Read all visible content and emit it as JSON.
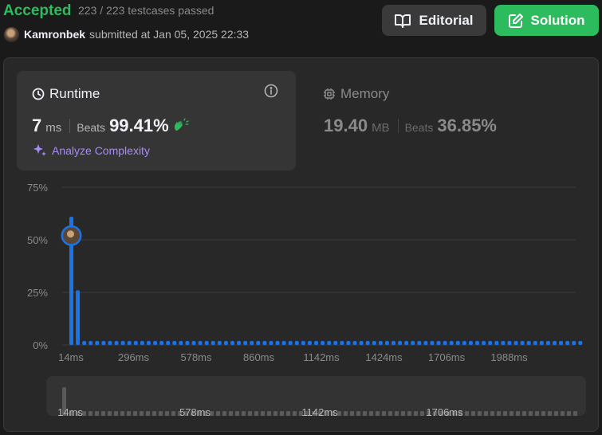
{
  "header": {
    "status": "Accepted",
    "testcases": "223 / 223 testcases passed",
    "username": "Kamronbek",
    "submitted_text": "submitted at Jan 05, 2025 22:33"
  },
  "buttons": {
    "editorial": "Editorial",
    "solution": "Solution"
  },
  "runtime": {
    "title": "Runtime",
    "value": "7",
    "unit": "ms",
    "beats_label": "Beats",
    "beats_pct": "99.41%",
    "analyze_label": "Analyze Complexity"
  },
  "memory": {
    "title": "Memory",
    "value": "19.40",
    "unit": "MB",
    "beats_label": "Beats",
    "beats_pct": "36.85%"
  },
  "colors": {
    "accent_green": "#2cbb5d",
    "bar_blue": "#1a73e8",
    "analyze_purple": "#a78bfa"
  },
  "icons": {
    "editorial": "book-open-icon",
    "solution": "edit-icon",
    "runtime": "clock-icon",
    "info": "info-icon",
    "memory": "chip-icon",
    "analyze": "sparkle-icon",
    "beats": "clapping-hands-icon"
  },
  "chart_data": {
    "type": "bar",
    "ylim": [
      0,
      75
    ],
    "yticks": [
      "0%",
      "25%",
      "50%",
      "75%"
    ],
    "xticks": [
      "14ms",
      "296ms",
      "578ms",
      "860ms",
      "1142ms",
      "1424ms",
      "1706ms",
      "1988ms"
    ],
    "values": [
      61,
      26,
      1.5,
      1.5,
      1.5,
      1.5,
      1.5,
      1.5,
      1.5,
      1.5,
      1.5,
      1.5,
      1.5,
      1.5,
      1.5,
      1.5,
      1.5,
      1.5,
      1.5,
      1.5,
      1.5,
      1.5,
      1.5,
      1.5,
      1.5,
      1.5,
      1.5,
      1.5,
      1.5,
      1.5,
      1.5,
      1.5,
      1.5,
      1.5,
      1.5,
      1.5,
      1.5,
      1.5,
      1.5,
      1.5,
      1.5,
      1.5,
      1.5,
      1.5,
      1.5,
      1.5,
      1.5,
      1.5,
      1.5,
      1.5,
      1.5,
      1.5,
      1.5,
      1.5,
      1.5,
      1.5,
      1.5,
      1.5,
      1.5,
      1.5,
      1.5,
      1.5,
      1.5,
      1.5,
      1.5,
      1.5,
      1.5,
      1.5,
      1.5,
      1.5,
      1.5,
      1.5,
      1.5,
      1.5,
      1.5,
      1.5,
      1.5,
      1.5,
      1.5,
      1.5
    ],
    "user_marker_index": 0,
    "user_marker_value": 52,
    "grid": true,
    "brush_xticks": [
      "14ms",
      "578ms",
      "1142ms",
      "1706ms"
    ]
  }
}
